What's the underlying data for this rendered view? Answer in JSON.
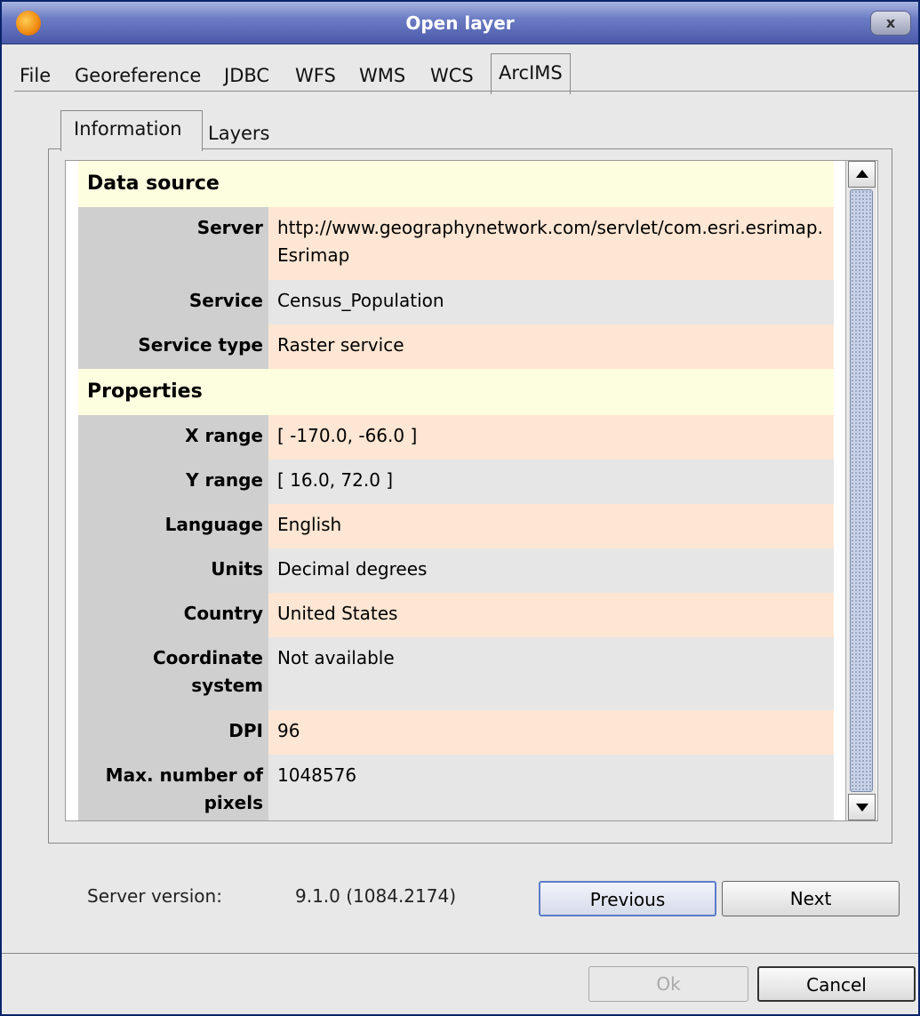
{
  "window": {
    "title": "Open layer",
    "close_symbol": "x"
  },
  "outer_tabs": [
    "File",
    "Georeference",
    "JDBC",
    "WFS",
    "WMS",
    "WCS",
    "ArcIMS"
  ],
  "active_outer_tab": "ArcIMS",
  "inner_tabs": [
    "Information",
    "Layers"
  ],
  "active_inner_tab": "Information",
  "info": {
    "data_source_heading": "Data source",
    "properties_heading": "Properties",
    "data_source": [
      {
        "label": "Server",
        "value": "http://www.geographynetwork.com/servlet/com.esri.esrimap.Esrimap"
      },
      {
        "label": "Service",
        "value": "Census_Population"
      },
      {
        "label": "Service type",
        "value": "Raster service"
      }
    ],
    "properties": [
      {
        "label": "X range",
        "value": "[ -170.0, -66.0 ]"
      },
      {
        "label": "Y range",
        "value": "[ 16.0, 72.0 ]"
      },
      {
        "label": "Language",
        "value": "English"
      },
      {
        "label": "Units",
        "value": "Decimal degrees"
      },
      {
        "label": "Country",
        "value": "United States"
      },
      {
        "label": "Coordinate system",
        "value": "Not available"
      },
      {
        "label": "DPI",
        "value": "96"
      },
      {
        "label": "Max. number of pixels",
        "value": "1048576"
      }
    ]
  },
  "footer": {
    "server_version_label": "Server version:",
    "server_version_value": "9.1.0 (1084.2174)",
    "previous_label": "Previous",
    "next_label": "Next",
    "ok_label": "Ok",
    "cancel_label": "Cancel"
  }
}
